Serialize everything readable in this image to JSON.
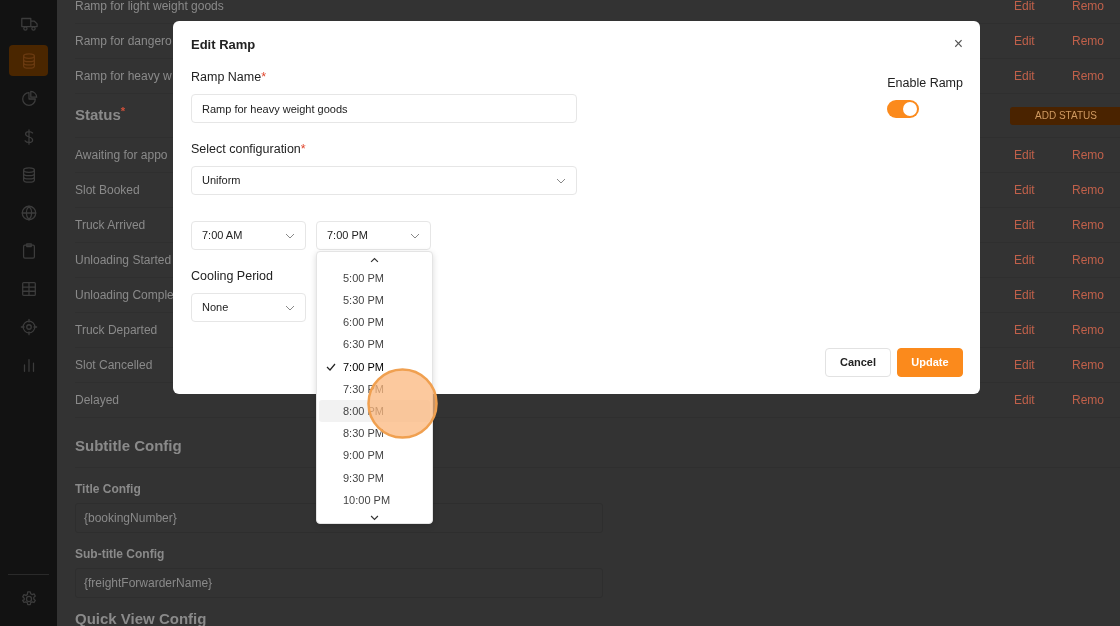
{
  "sidebar": {
    "items": [
      {
        "kind": "truck",
        "selected": false
      },
      {
        "kind": "database",
        "selected": true
      },
      {
        "kind": "pie",
        "selected": false
      },
      {
        "kind": "dollar",
        "selected": false
      },
      {
        "kind": "database",
        "selected": false
      },
      {
        "kind": "globe",
        "selected": false
      },
      {
        "kind": "clipboard",
        "selected": false
      },
      {
        "kind": "grid",
        "selected": false
      },
      {
        "kind": "target",
        "selected": false
      },
      {
        "kind": "bars",
        "selected": false
      }
    ],
    "footer_items": [
      {
        "kind": "gear",
        "selected": false
      }
    ]
  },
  "ramps": {
    "rows": [
      {
        "name": "Ramp for light weight goods",
        "actions": [
          "Edit",
          "Remo"
        ]
      },
      {
        "name": "Ramp for dangero",
        "actions": [
          "Edit",
          "Remo"
        ]
      },
      {
        "name": "Ramp for heavy w",
        "actions": [
          "Edit",
          "Remo"
        ]
      }
    ]
  },
  "status": {
    "title": "Status",
    "mark": "*",
    "add_button": "ADD STATUS",
    "rows": [
      {
        "name": "Awaiting for appo",
        "actions": [
          "Edit",
          "Remo"
        ]
      },
      {
        "name": "Slot Booked",
        "actions": [
          "Edit",
          "Remo"
        ]
      },
      {
        "name": "Truck Arrived",
        "actions": [
          "Edit",
          "Remo"
        ]
      },
      {
        "name": "Unloading Started",
        "actions": [
          "Edit",
          "Remo"
        ]
      },
      {
        "name": "Unloading Comple",
        "actions": [
          "Edit",
          "Remo"
        ]
      },
      {
        "name": "Truck Departed",
        "actions": [
          "Edit",
          "Remo"
        ]
      },
      {
        "name": "Slot Cancelled",
        "actions": [
          "Edit",
          "Remo"
        ]
      },
      {
        "name": "Delayed",
        "actions": [
          "Edit",
          "Remo"
        ]
      }
    ]
  },
  "subtitle_config": {
    "title": "Subtitle Config",
    "fields": [
      {
        "label": "Title Config",
        "value": "{bookingNumber}"
      },
      {
        "label": "Sub-title Config",
        "value": "{freightForwarderName}"
      }
    ]
  },
  "quick_view_config": {
    "title": "Quick View Config"
  },
  "modal": {
    "title": "Edit Ramp",
    "close": "×",
    "ramp_name": {
      "label": "Ramp Name",
      "mark": "*",
      "value": "Ramp for heavy weight goods"
    },
    "enable_ramp": {
      "label": "Enable Ramp",
      "on": true
    },
    "configuration": {
      "label": "Select configuration",
      "mark": "*",
      "value": "Uniform"
    },
    "start_time": {
      "value": "7:00 AM"
    },
    "end_time": {
      "value": "7:00 PM",
      "open": true
    },
    "cooling_period": {
      "label": "Cooling Period",
      "value": "None"
    },
    "time_options": [
      {
        "label": "5:00 PM",
        "selected": false,
        "hovered": false
      },
      {
        "label": "5:30 PM",
        "selected": false,
        "hovered": false
      },
      {
        "label": "6:00 PM",
        "selected": false,
        "hovered": false
      },
      {
        "label": "6:30 PM",
        "selected": false,
        "hovered": false
      },
      {
        "label": "7:00 PM",
        "selected": true,
        "hovered": false
      },
      {
        "label": "7:30 PM",
        "selected": false,
        "hovered": false
      },
      {
        "label": "8:00 PM",
        "selected": false,
        "hovered": true
      },
      {
        "label": "8:30 PM",
        "selected": false,
        "hovered": false
      },
      {
        "label": "9:00 PM",
        "selected": false,
        "hovered": false
      },
      {
        "label": "9:30 PM",
        "selected": false,
        "hovered": false
      },
      {
        "label": "10:00 PM",
        "selected": false,
        "hovered": false
      }
    ],
    "buttons": [
      {
        "label": "Cancel",
        "kind": "secondary"
      },
      {
        "label": "Update",
        "kind": "primary"
      }
    ]
  },
  "cursor": {
    "kind": "click-highlight"
  }
}
